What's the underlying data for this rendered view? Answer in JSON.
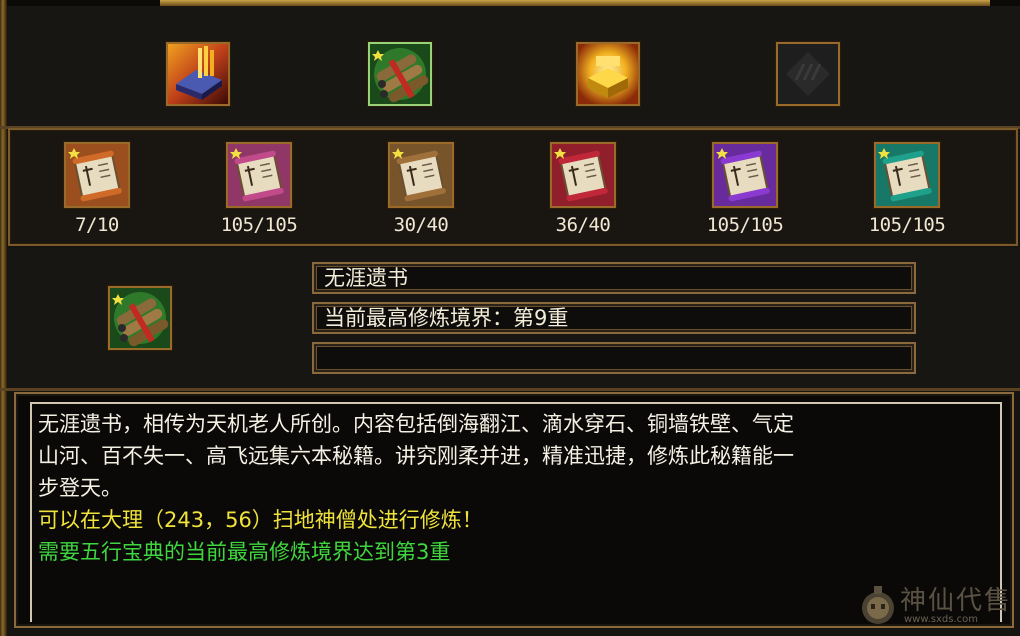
{
  "top_items": [
    {
      "icon": "golden-book-icon",
      "state": "normal"
    },
    {
      "icon": "scroll-bundle-icon",
      "state": "selected"
    },
    {
      "icon": "gold-treasure-icon",
      "state": "normal"
    },
    {
      "icon": "empty-slot-icon",
      "state": "empty"
    }
  ],
  "scrolls": [
    {
      "icon": "orange-scroll-icon",
      "color": "#d06a28",
      "count": "7/10"
    },
    {
      "icon": "pink-scroll-icon",
      "color": "#c04a8a",
      "count": "105/105"
    },
    {
      "icon": "bronze-scroll-icon",
      "color": "#a0703a",
      "count": "30/40"
    },
    {
      "icon": "red-scroll-icon",
      "color": "#c0283a",
      "count": "36/40"
    },
    {
      "icon": "purple-scroll-icon",
      "color": "#8a3ad0",
      "count": "105/105"
    },
    {
      "icon": "teal-scroll-icon",
      "color": "#1fa08a",
      "count": "105/105"
    }
  ],
  "selected": {
    "icon": "scroll-bundle-icon",
    "name": "无涯遗书",
    "realm": "当前最高修炼境界：第9重",
    "extra": ""
  },
  "description": {
    "lines": [
      "无涯遗书，相传为天机老人所创。内容包括倒海翻江、滴水穿石、铜墙铁壁、气定",
      "山河、百不失一、高飞远集六本秘籍。讲究刚柔并进，精准迅捷，修炼此秘籍能一",
      "步登天。"
    ],
    "location": "可以在大理（243，56）扫地神僧处进行修炼！",
    "requirement": "需要五行宝典的当前最高修炼境界达到第3重"
  },
  "watermark": {
    "text": "神仙代售",
    "url": "www.sxds.com"
  },
  "colors": {
    "accent_yellow": "#f0e33c",
    "accent_green": "#3fd63f",
    "frame_gold": "#8a6a3a"
  }
}
